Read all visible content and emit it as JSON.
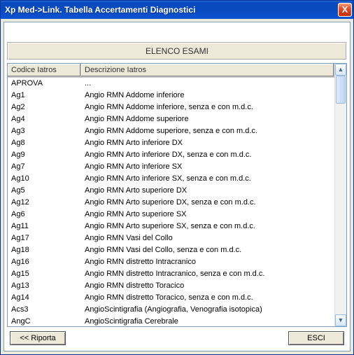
{
  "window": {
    "title": "Xp Med->Link. Tabella Accertamenti Diagnostici",
    "close_icon": "X"
  },
  "panel": {
    "title": "ELENCO ESAMI"
  },
  "columns": {
    "code": "Codice Iatros",
    "desc": "Descrizione Iatros"
  },
  "rows": [
    {
      "code": "APROVA",
      "desc": "..."
    },
    {
      "code": "Ag1",
      "desc": "Angio RMN Addome inferiore"
    },
    {
      "code": "Ag2",
      "desc": "Angio RMN Addome inferiore, senza e con m.d.c."
    },
    {
      "code": "Ag4",
      "desc": "Angio RMN Addome superiore"
    },
    {
      "code": "Ag3",
      "desc": "Angio RMN Addome superiore, senza e con m.d.c."
    },
    {
      "code": "Ag8",
      "desc": "Angio RMN Arto inferiore DX"
    },
    {
      "code": "Ag9",
      "desc": "Angio RMN Arto inferiore DX, senza e con m.d.c."
    },
    {
      "code": "Ag7",
      "desc": "Angio RMN Arto inferiore SX"
    },
    {
      "code": "Ag10",
      "desc": "Angio RMN Arto inferiore SX, senza e con m.d.c."
    },
    {
      "code": "Ag5",
      "desc": "Angio RMN Arto superiore DX"
    },
    {
      "code": "Ag12",
      "desc": "Angio RMN Arto superiore DX, senza e con m.d.c."
    },
    {
      "code": "Ag6",
      "desc": "Angio RMN Arto superiore SX"
    },
    {
      "code": "Ag11",
      "desc": "Angio RMN Arto superiore SX, senza e con m.d.c."
    },
    {
      "code": "Ag17",
      "desc": "Angio RMN Vasi del Collo"
    },
    {
      "code": "Ag18",
      "desc": "Angio RMN Vasi del Collo, senza e con m.d.c."
    },
    {
      "code": "Ag16",
      "desc": "Angio RMN distretto Intracranico"
    },
    {
      "code": "Ag15",
      "desc": "Angio RMN distretto Intracranico, senza e con m.d.c."
    },
    {
      "code": "Ag13",
      "desc": "Angio RMN distretto Toracico"
    },
    {
      "code": "Ag14",
      "desc": "Angio RMN distretto Toracico, senza e con m.d.c."
    },
    {
      "code": "Acs3",
      "desc": "AngioScintigrafia (Angiografia, Venografia isotopica)"
    },
    {
      "code": "AngC",
      "desc": "AngioScintigrafia Cerebrale"
    }
  ],
  "footer": {
    "riporta": "<< Riporta",
    "esci": "ESCI"
  },
  "scrollbar": {
    "up": "▲",
    "down": "▼"
  }
}
